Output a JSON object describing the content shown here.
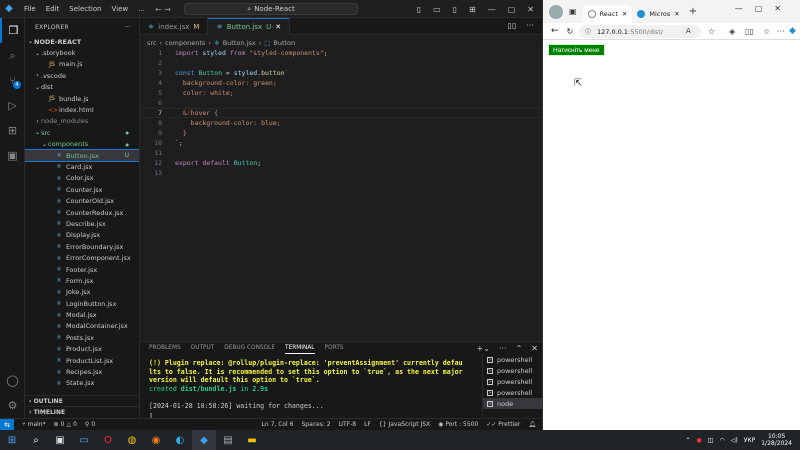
{
  "vscode": {
    "menu": [
      "File",
      "Edit",
      "Selection",
      "View",
      "..."
    ],
    "command_center": "Node-React",
    "explorer_title": "EXPLORER",
    "project": "NODE-REACT",
    "tree": [
      {
        "label": ".storybook",
        "type": "folder",
        "indent": 1,
        "open": true
      },
      {
        "label": "main.js",
        "type": "js",
        "indent": 2
      },
      {
        "label": ".vscode",
        "type": "folder",
        "indent": 1,
        "open": false
      },
      {
        "label": "dist",
        "type": "folder",
        "indent": 1,
        "open": true
      },
      {
        "label": "bundle.js",
        "type": "js",
        "indent": 2
      },
      {
        "label": "index.html",
        "type": "html",
        "indent": 2
      },
      {
        "label": "node_modules",
        "type": "folder",
        "indent": 1,
        "open": false,
        "dim": true
      },
      {
        "label": "src",
        "type": "folder",
        "indent": 1,
        "open": true,
        "green": true,
        "dot": "●"
      },
      {
        "label": "components",
        "type": "folder",
        "indent": 2,
        "open": true,
        "green": true,
        "dot": "●"
      },
      {
        "label": "Button.jsx",
        "type": "jsx",
        "indent": 3,
        "selected": true,
        "badge": "U"
      },
      {
        "label": "Card.jsx",
        "type": "jsx",
        "indent": 3
      },
      {
        "label": "Color.jsx",
        "type": "jsx",
        "indent": 3
      },
      {
        "label": "Counter.jsx",
        "type": "jsx",
        "indent": 3
      },
      {
        "label": "CounterOld.jsx",
        "type": "jsx",
        "indent": 3
      },
      {
        "label": "CounterRedux.jsx",
        "type": "jsx",
        "indent": 3
      },
      {
        "label": "Describe.jsx",
        "type": "jsx",
        "indent": 3
      },
      {
        "label": "Display.jsx",
        "type": "jsx",
        "indent": 3
      },
      {
        "label": "ErrorBoundary.jsx",
        "type": "jsx",
        "indent": 3
      },
      {
        "label": "ErrorComponent.jsx",
        "type": "jsx",
        "indent": 3
      },
      {
        "label": "Footer.jsx",
        "type": "jsx",
        "indent": 3
      },
      {
        "label": "Form.jsx",
        "type": "jsx",
        "indent": 3
      },
      {
        "label": "Joke.jsx",
        "type": "jsx",
        "indent": 3
      },
      {
        "label": "LoginButton.jsx",
        "type": "jsx",
        "indent": 3
      },
      {
        "label": "Modal.jsx",
        "type": "jsx",
        "indent": 3
      },
      {
        "label": "ModalContainer.jsx",
        "type": "jsx",
        "indent": 3
      },
      {
        "label": "Posts.jsx",
        "type": "jsx",
        "indent": 3
      },
      {
        "label": "Product.jsx",
        "type": "jsx",
        "indent": 3
      },
      {
        "label": "ProductList.jsx",
        "type": "jsx",
        "indent": 3
      },
      {
        "label": "Recipes.jsx",
        "type": "jsx",
        "indent": 3
      },
      {
        "label": "State.jsx",
        "type": "jsx",
        "indent": 3
      }
    ],
    "outline": "OUTLINE",
    "timeline": "TIMELINE",
    "tabs": [
      {
        "label": "index.jsx",
        "status": "M",
        "active": false
      },
      {
        "label": "Button.jsx",
        "status": "U",
        "active": true
      }
    ],
    "breadcrumb": [
      "src",
      "components",
      "Button.jsx",
      "Button"
    ],
    "code_lines": [
      "import styled from \"styled-components\";",
      "",
      "const Button = styled.button`",
      "  background-color: green;",
      "  color: white;",
      "",
      "  &:hover {",
      "    background-color: blue;",
      "  }",
      "`;",
      "",
      "export default Button;",
      ""
    ],
    "current_line": 7,
    "panel_tabs": [
      "PROBLEMS",
      "OUTPUT",
      "DEBUG CONSOLE",
      "TERMINAL",
      "PORTS"
    ],
    "panel_active": "TERMINAL",
    "terminal": {
      "warn_1": "(!) Plugin replace: @rollup/plugin-replace: 'preventAssignment' currently defau",
      "warn_2": "lts to false. It is recommended to set this option to `true`, as the next major",
      "warn_3": "version will default this option to `true`.",
      "created_prefix": "created ",
      "created_file": "dist/bundle.js",
      "created_in": " in ",
      "created_time": "2.9s",
      "waiting": "[2024-01-28 10:58:26] waiting for changes...",
      "prompt": "▯"
    },
    "terminal_list": [
      "powershell",
      "powershell",
      "powershell",
      "powershell",
      "node"
    ],
    "status": {
      "branch": "main*",
      "errors": "0",
      "warnings": "0",
      "ports": "0",
      "cursor": "Ln 7, Col 6",
      "spaces": "Spaces: 2",
      "encoding": "UTF-8",
      "eol": "LF",
      "language": "JavaScript JSX",
      "port": "Port : 5500",
      "prettier": "Prettier"
    }
  },
  "edge": {
    "tabs": [
      {
        "label": "React",
        "active": true
      },
      {
        "label": "Micros",
        "active": false
      }
    ],
    "address_main": "127.0.0.1",
    "address_rest": ":5500/dist/",
    "page_button": "Натисніть мене"
  },
  "taskbar": {
    "lang": "УКР",
    "time": "10:05",
    "date": "1/28/2024"
  }
}
